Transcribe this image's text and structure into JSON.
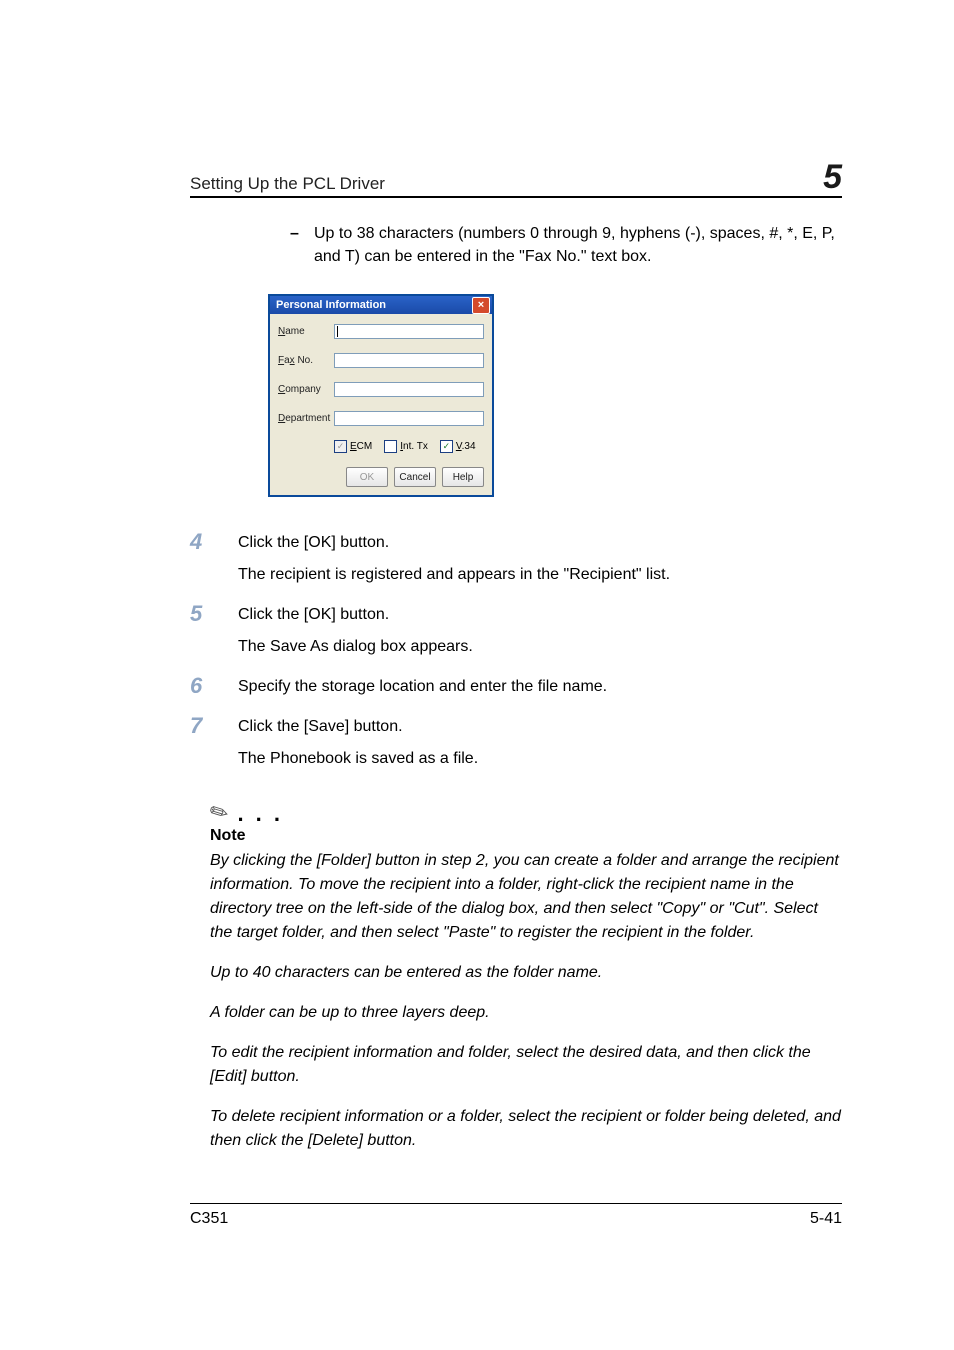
{
  "header": {
    "title": "Setting Up the PCL Driver",
    "chapter": "5"
  },
  "bullet": {
    "dash": "–",
    "text": "Up to 38 characters (numbers 0 through 9, hyphens (-), spaces, #, *, E, P, and T) can be entered in the \"Fax No.\" text box."
  },
  "dialog": {
    "title": "Personal Information",
    "labels": {
      "name": "Name",
      "fax": "Fax No.",
      "company": "Company",
      "department": "Department"
    },
    "checks": {
      "ecm": "ECM",
      "inttx": "Int. Tx",
      "v34": "V.34"
    },
    "buttons": {
      "ok": "OK",
      "cancel": "Cancel",
      "help": "Help"
    }
  },
  "steps": [
    {
      "n": "4",
      "l1": "Click the [OK] button.",
      "l2": "The recipient is registered and appears in the \"Recipient\" list."
    },
    {
      "n": "5",
      "l1": "Click the [OK] button.",
      "l2": "The Save As dialog box appears."
    },
    {
      "n": "6",
      "l1": "Specify the storage location and enter the file name.",
      "l2": ""
    },
    {
      "n": "7",
      "l1": "Click the [Save] button.",
      "l2": "The Phonebook is saved as a file."
    }
  ],
  "note": {
    "heading": "Note",
    "paras": [
      "By clicking the [Folder] button in step 2, you can create a folder and arrange the recipient information. To move the recipient into a folder, right-click the recipient name in the directory tree on the left-side of the dialog box, and then select \"Copy\" or \"Cut\". Select the target folder, and then select \"Paste\" to register the recipient in the folder.",
      "Up to 40 characters can be entered as the folder name.",
      "A folder can be up to three layers deep.",
      "To edit the recipient information and folder, select the desired data, and then click the [Edit] button.",
      "To delete recipient information or a folder, select the recipient or folder being deleted, and then click the [Delete] button."
    ]
  },
  "footer": {
    "left": "C351",
    "right": "5-41"
  }
}
